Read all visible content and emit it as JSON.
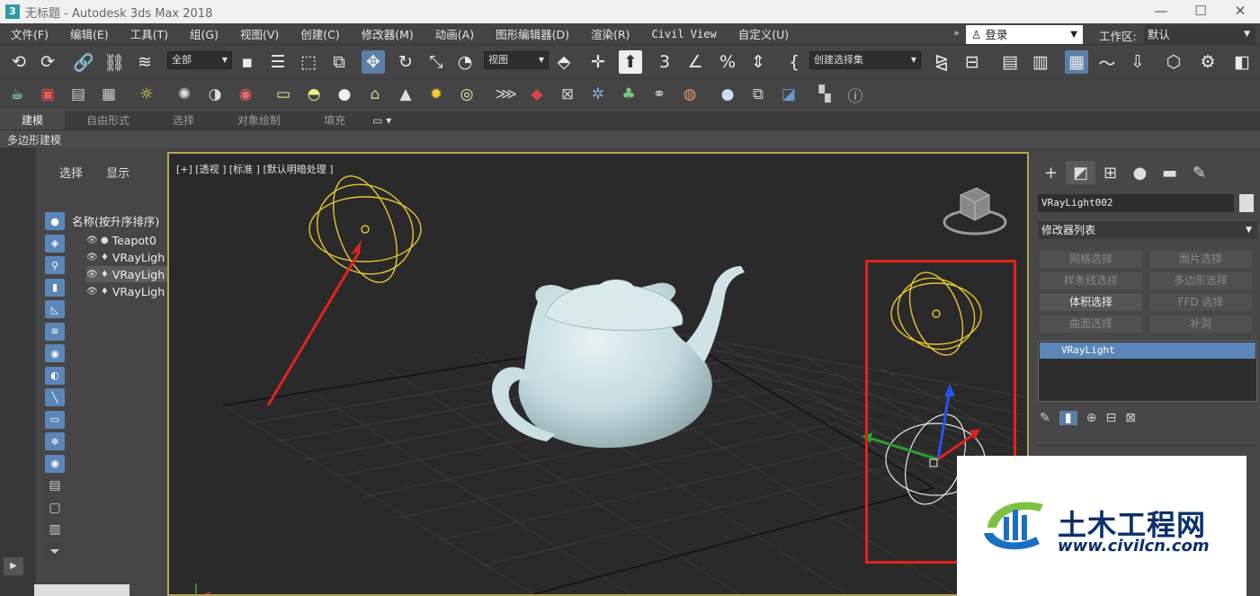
{
  "window": {
    "title": "无标题 - Autodesk 3ds Max 2018",
    "app_icon": "3",
    "controls": [
      "minimize-icon",
      "maximize-icon",
      "close-icon"
    ]
  },
  "menu": [
    "文件(F)",
    "编辑(E)",
    "工具(T)",
    "组(G)",
    "视图(V)",
    "创建(C)",
    "修改器(M)",
    "动画(A)",
    "图形编辑器(D)",
    "渲染(R)",
    "Civil View",
    "自定义(U)"
  ],
  "menu_overflow": "»",
  "signin": {
    "label": "登录"
  },
  "workspace": {
    "label": "工作区:",
    "value": "默认"
  },
  "toolbar": {
    "selection_filter": "全部",
    "ref_coord": "视图",
    "named_selection": "创建选择集"
  },
  "ribbon": {
    "tabs": [
      "建模",
      "自由形式",
      "选择",
      "对象绘制",
      "填充"
    ],
    "active_tab": "建模",
    "sub_panel": "多边形建模"
  },
  "scene_explorer": {
    "tabs": [
      "选择",
      "显示"
    ],
    "column_header": "名称(按升序排序)",
    "items": [
      {
        "name": "Teapot0",
        "selected": false
      },
      {
        "name": "VRayLigh",
        "selected": false
      },
      {
        "name": "VRayLigh",
        "selected": true
      },
      {
        "name": "VRayLigh",
        "selected": false
      }
    ]
  },
  "viewport": {
    "label": "[+] [透视 ] [标准 ] [默认明暗处理 ]"
  },
  "command_panel": {
    "object_name": "VRayLight002",
    "modifier_list": "修改器列表",
    "modifier_buttons": [
      {
        "label": "网格选择",
        "enabled": false
      },
      {
        "label": "面片选择",
        "enabled": false
      },
      {
        "label": "样条线选择",
        "enabled": false
      },
      {
        "label": "多边形选择",
        "enabled": false
      },
      {
        "label": "体积选择",
        "enabled": true
      },
      {
        "label": "FFD 选择",
        "enabled": false
      },
      {
        "label": "曲面选择",
        "enabled": false
      },
      {
        "label": "补洞",
        "enabled": false
      }
    ],
    "stack_item": "VRayLight"
  },
  "watermark": {
    "title": "土木工程网",
    "url": "www.civilcn.com"
  },
  "colors": {
    "accent": "#5b86b8",
    "viewport_border": "#b8a255",
    "highlight_box": "#e2231a",
    "light_gizmo": "#e8c531",
    "teapot": "#c7dde0"
  }
}
